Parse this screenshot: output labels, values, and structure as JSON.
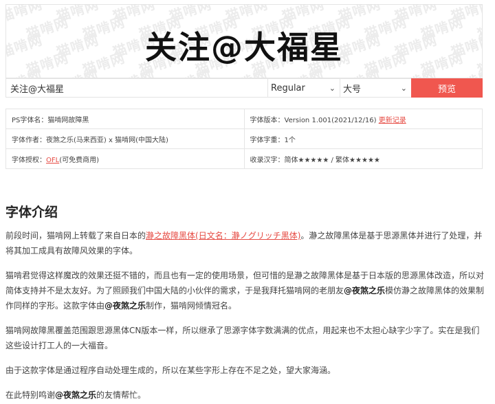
{
  "preview": {
    "display_text": "关注@大福星",
    "watermark": "猫啃网"
  },
  "controls": {
    "input_value": "关注@大福星",
    "weight_selected": "Regular",
    "size_selected": "大号",
    "preview_button": "预览"
  },
  "info": {
    "ps_name": "PS字体名：猫啃网故障黑",
    "version_text": "字体版本：Version 1.001(2021/12/16) ",
    "changelog_link": "更新记录",
    "author": "字体作者：夜煞之乐(马来西亚) x 猫啃网(中国大陆)",
    "weight_count": "字体字重：1个",
    "license_label": "字体授权：",
    "license_link": "OFL",
    "license_suffix": "(可免费商用)",
    "coverage": "收录汉字：简体★★★★★ / 繁体★★★★★"
  },
  "intro": {
    "title": "字体介绍",
    "p1_a": "前段时间，猫啃网上转载了来自日本的",
    "p1_link": "瀞之故障黑体(日文名：瀞ノグリッチ黒体)",
    "p1_b": "。瀞之故障黑体是基于思源黑体并进行了处理，并将其加工成具有故障风效果的字体。",
    "p2_a": "猫啃君觉得这样魔改的效果还挺不错的，而且也有一定的使用场景，但可惜的是瀞之故障黑体是基于日本版的思源黑体改造，所以对简体支持并不是太友好。为了照顾我们中国大陆的小伙伴的需求，于是我拜托猫啃网的老朋友",
    "p2_bold1": "@夜煞之乐",
    "p2_b": "模仿瀞之故障黑体的效果制作同样的字形。这款字体由",
    "p2_bold2": "@夜煞之乐",
    "p2_c": "制作，猫啃网倾情冠名。",
    "p3": "猫啃网故障黑覆盖范围跟思源黑体CN版本一样，所以继承了思源字体字数满满的优点，用起来也不太担心缺字少字了。实在是我们这些设计打工人的一大福音。",
    "p4": "由于这款字体是通过程序自动处理生成的，所以在某些字形上存在不足之处，望大家海涵。",
    "p5_a": "在此特别鸣谢",
    "p5_bold": "@夜煞之乐",
    "p5_b": "的友情帮忙。"
  }
}
